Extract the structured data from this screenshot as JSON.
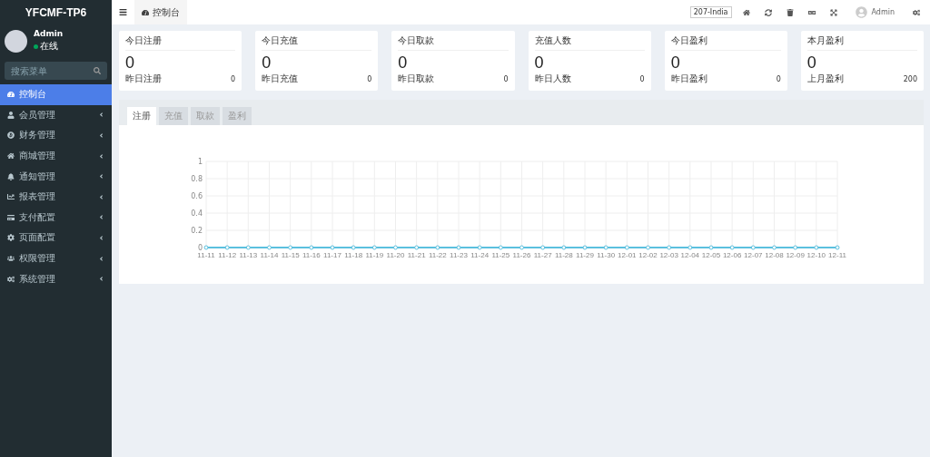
{
  "sidebar": {
    "logo": "YFCMF-TP6",
    "user": {
      "name": "Admin",
      "status": "在线"
    },
    "search": {
      "placeholder": "搜索菜单"
    },
    "items": [
      {
        "label": "控制台",
        "selected": true,
        "has_children": false
      },
      {
        "label": "会员管理",
        "selected": false,
        "has_children": true
      },
      {
        "label": "财务管理",
        "selected": false,
        "has_children": true
      },
      {
        "label": "商城管理",
        "selected": false,
        "has_children": true
      },
      {
        "label": "通知管理",
        "selected": false,
        "has_children": true
      },
      {
        "label": "报表管理",
        "selected": false,
        "has_children": true
      },
      {
        "label": "支付配置",
        "selected": false,
        "has_children": true
      },
      {
        "label": "页面配置",
        "selected": false,
        "has_children": true
      },
      {
        "label": "权限管理",
        "selected": false,
        "has_children": true
      },
      {
        "label": "系统管理",
        "selected": false,
        "has_children": true
      }
    ]
  },
  "header": {
    "tab": "控制台",
    "badge": "207-India",
    "user": "Admin"
  },
  "stats": [
    {
      "title": "今日注册",
      "value": "0",
      "sub_label": "昨日注册",
      "sub_value": "0"
    },
    {
      "title": "今日充值",
      "value": "0",
      "sub_label": "昨日充值",
      "sub_value": "0"
    },
    {
      "title": "今日取款",
      "value": "0",
      "sub_label": "昨日取款",
      "sub_value": "0"
    },
    {
      "title": "充值人数",
      "value": "0",
      "sub_label": "昨日人数",
      "sub_value": "0"
    },
    {
      "title": "今日盈利",
      "value": "0",
      "sub_label": "昨日盈利",
      "sub_value": "0"
    },
    {
      "title": "本月盈利",
      "value": "0",
      "sub_label": "上月盈利",
      "sub_value": "200"
    }
  ],
  "chart_tabs": [
    {
      "label": "注册",
      "selected": true
    },
    {
      "label": "充值",
      "selected": false
    },
    {
      "label": "取款",
      "selected": false
    },
    {
      "label": "盈利",
      "selected": false
    }
  ],
  "chart_data": {
    "type": "line",
    "grid": true,
    "categories": [
      "11-11",
      "11-12",
      "11-13",
      "11-14",
      "11-15",
      "11-16",
      "11-17",
      "11-18",
      "11-19",
      "11-20",
      "11-21",
      "11-22",
      "11-23",
      "11-24",
      "11-25",
      "11-26",
      "11-27",
      "11-28",
      "11-29",
      "11-30",
      "12-01",
      "12-02",
      "12-03",
      "12-04",
      "12-05",
      "12-06",
      "12-07",
      "12-08",
      "12-09",
      "12-10",
      "12-11"
    ],
    "series": [
      {
        "color": "#5bc0de",
        "marker": "circle",
        "values": [
          0,
          0,
          0,
          0,
          0,
          0,
          0,
          0,
          0,
          0,
          0,
          0,
          0,
          0,
          0,
          0,
          0,
          0,
          0,
          0,
          0,
          0,
          0,
          0,
          0,
          0,
          0,
          0,
          0,
          0,
          0
        ]
      }
    ],
    "ylim": [
      0,
      1
    ],
    "yticks": [
      0,
      0.2,
      0.4,
      0.6,
      0.8,
      1
    ]
  }
}
